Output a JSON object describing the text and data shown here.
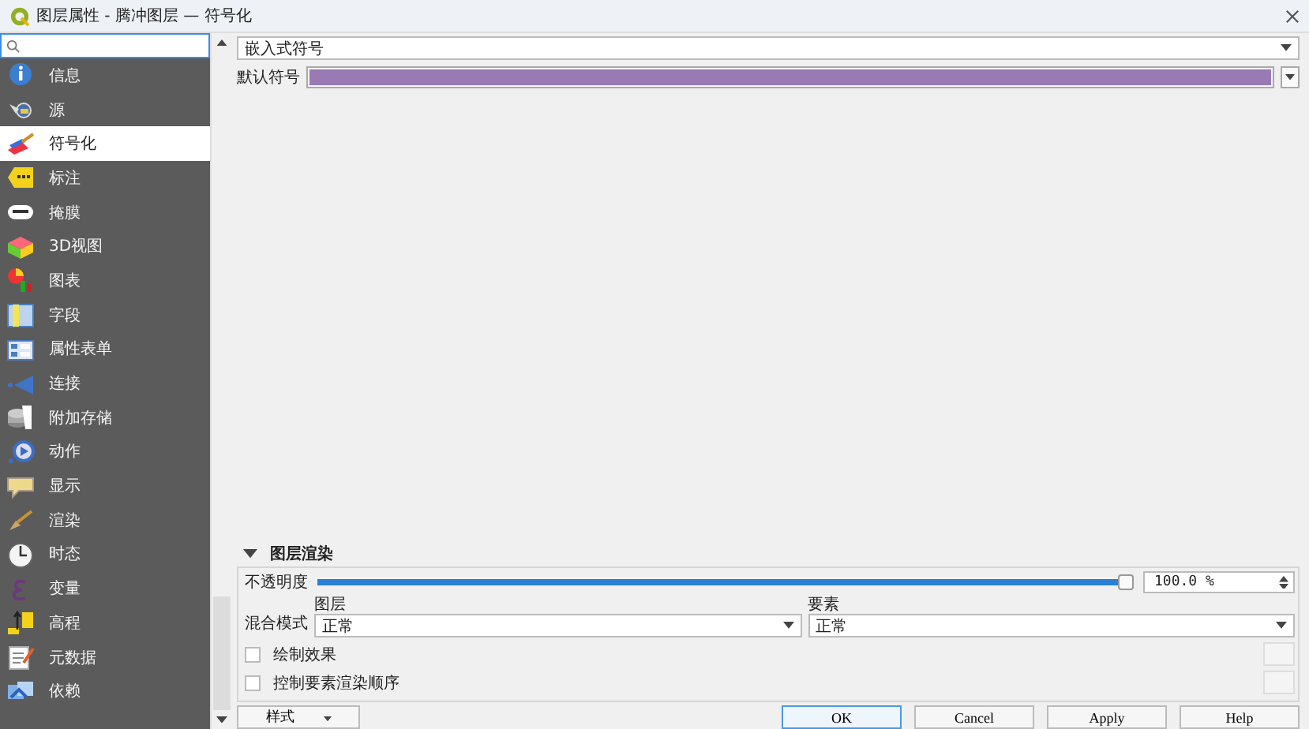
{
  "window": {
    "title": "图层属性 - 腾冲图层 — 符号化"
  },
  "sidebar": {
    "items": [
      {
        "label": "信息",
        "selected": false
      },
      {
        "label": "源",
        "selected": false
      },
      {
        "label": "符号化",
        "selected": true
      },
      {
        "label": "标注",
        "selected": false
      },
      {
        "label": "掩膜",
        "selected": false
      },
      {
        "label": "3D视图",
        "selected": false
      },
      {
        "label": "图表",
        "selected": false
      },
      {
        "label": "字段",
        "selected": false
      },
      {
        "label": "属性表单",
        "selected": false
      },
      {
        "label": "连接",
        "selected": false
      },
      {
        "label": "附加存储",
        "selected": false
      },
      {
        "label": "动作",
        "selected": false
      },
      {
        "label": "显示",
        "selected": false
      },
      {
        "label": "渲染",
        "selected": false
      },
      {
        "label": "时态",
        "selected": false
      },
      {
        "label": "变量",
        "selected": false
      },
      {
        "label": "高程",
        "selected": false
      },
      {
        "label": "元数据",
        "selected": false
      },
      {
        "label": "依赖",
        "selected": false
      }
    ]
  },
  "renderer": {
    "value": "嵌入式符号"
  },
  "symbol": {
    "label": "默认符号"
  },
  "layer_rendering": {
    "title": "图层渲染",
    "expanded": true,
    "opacity": {
      "label": "不透明度",
      "level": 1.0,
      "reading": "100.0 %"
    },
    "blending": {
      "label": "混合模式",
      "layer": {
        "label": "图层",
        "value": "正常"
      },
      "feature": {
        "label": "要素",
        "value": "正常"
      }
    },
    "options": [
      {
        "label": "绘制效果",
        "checked": false
      },
      {
        "label": "控制要素渲染顺序",
        "checked": false
      }
    ]
  },
  "buttons": {
    "style": "样式",
    "actions": [
      "OK",
      "Cancel",
      "Apply",
      "Help"
    ]
  }
}
